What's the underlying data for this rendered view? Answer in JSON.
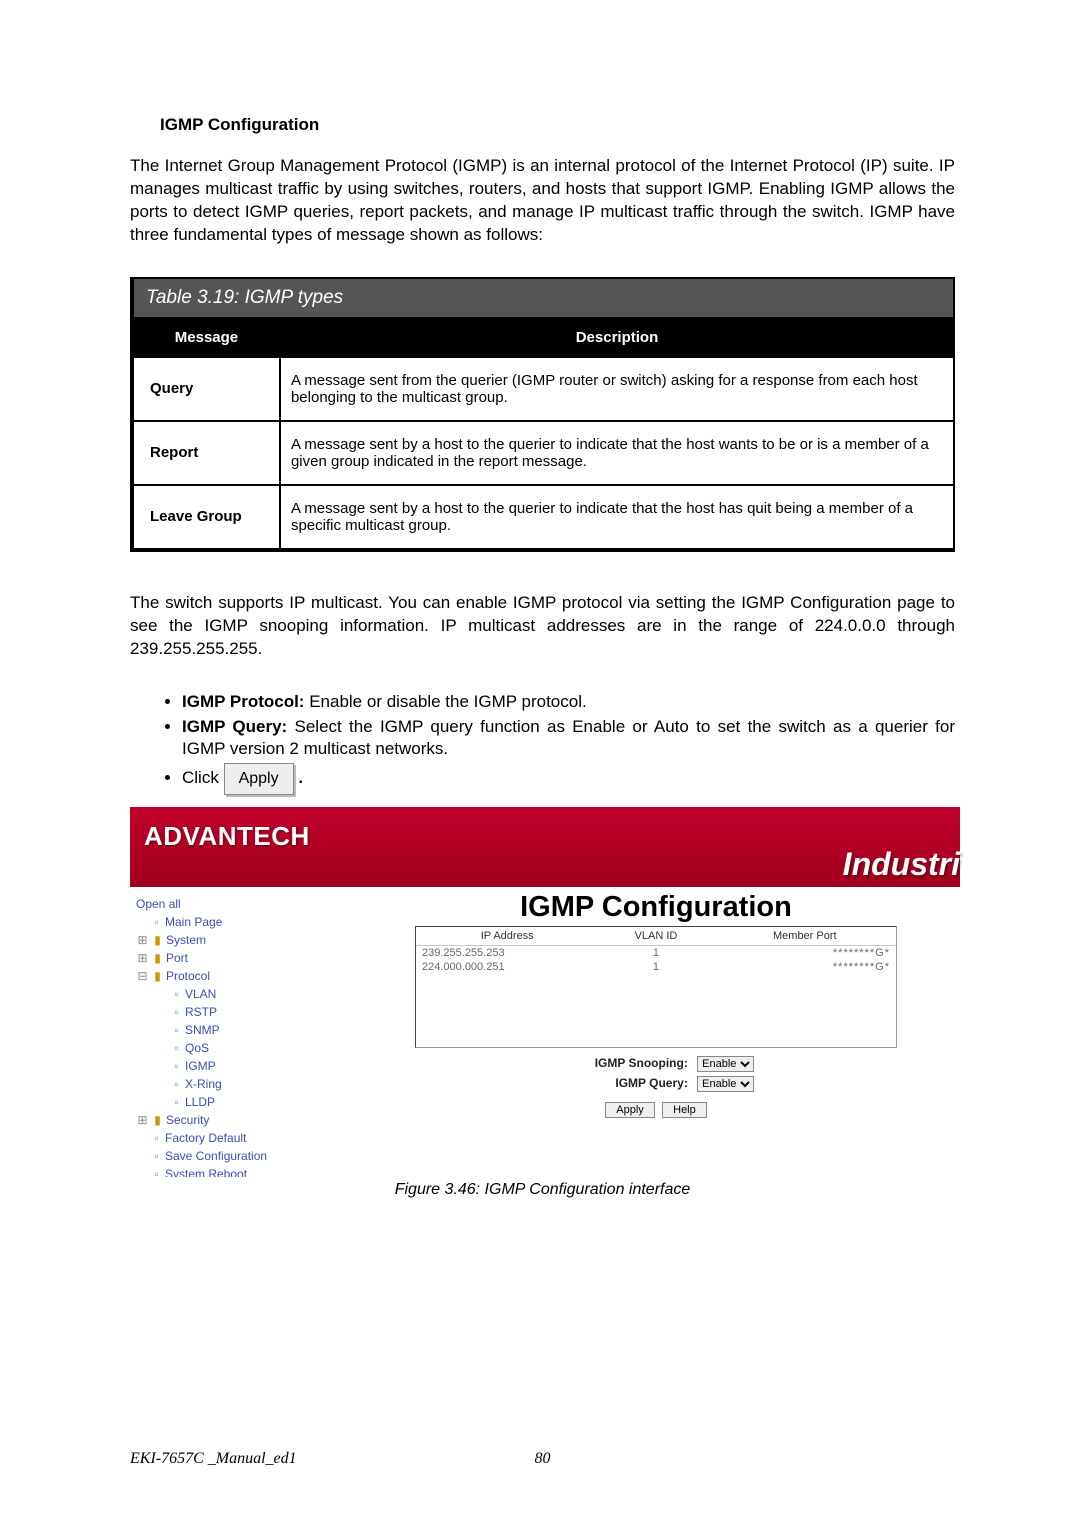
{
  "section_title": "IGMP Configuration",
  "intro": "The Internet Group Management Protocol (IGMP) is an internal protocol of the Internet Protocol (IP) suite. IP manages multicast traffic by using switches, routers, and hosts that support IGMP. Enabling IGMP allows the ports to detect IGMP queries, report packets, and manage IP multicast traffic through the switch. IGMP have three fundamental types of message shown as follows:",
  "table": {
    "title": "Table 3.19: IGMP types",
    "col_message": "Message",
    "col_description": "Description",
    "rows": [
      {
        "msg": "Query",
        "desc": "A message sent from the querier (IGMP router or switch) asking for a response from each host belonging to the multicast group."
      },
      {
        "msg": "Report",
        "desc": "A message sent by a host to the querier to indicate that the host wants to be or is a member of a given group indicated in the report message."
      },
      {
        "msg": "Leave Group",
        "desc": "A message sent by a host to the querier to indicate that the host has quit being a member of a specific multicast group."
      }
    ]
  },
  "para2": "The switch supports IP multicast. You can enable IGMP protocol via setting the IGMP Configuration page to see the IGMP snooping information. IP multicast addresses are in the range of 224.0.0.0 through 239.255.255.255.",
  "bullets": {
    "b1_label": "IGMP Protocol:",
    "b1_text": " Enable or disable the IGMP protocol.",
    "b2_label": "IGMP Query:",
    "b2_text": " Select the IGMP query function as Enable or Auto to set the switch as a querier for IGMP version 2 multicast networks.",
    "b3_pre": "Click ",
    "b3_btn": "Apply",
    "b3_post": "."
  },
  "screenshot": {
    "brand": "ADVANTECH",
    "industri": "Industri",
    "tree": {
      "open_all": "Open all",
      "main_page": "Main Page",
      "system": "System",
      "port": "Port",
      "protocol": "Protocol",
      "vlan": "VLAN",
      "rstp": "RSTP",
      "snmp": "SNMP",
      "qos": "QoS",
      "igmp": "IGMP",
      "xring": "X-Ring",
      "lldp": "LLDP",
      "security": "Security",
      "factory": "Factory Default",
      "savecfg": "Save Configuration",
      "reboot": "System Reboot"
    },
    "content": {
      "title": "IGMP Configuration",
      "hdr_ip": "IP Address",
      "hdr_vlan": "VLAN ID",
      "hdr_member": "Member Port",
      "rows": [
        {
          "ip": "239.255.255.253",
          "vlan": "1",
          "mp": "********G*"
        },
        {
          "ip": "224.000.000.251",
          "vlan": "1",
          "mp": "********G*"
        }
      ],
      "snoop_label": "IGMP Snooping:",
      "snoop_value": "Enable",
      "query_label": "IGMP Query:",
      "query_value": "Enable",
      "apply_btn": "Apply",
      "help_btn": "Help"
    }
  },
  "figure_caption": "Figure 3.46: IGMP Configuration interface",
  "footer_left": "EKI-7657C _Manual_ed1",
  "footer_page": "80"
}
